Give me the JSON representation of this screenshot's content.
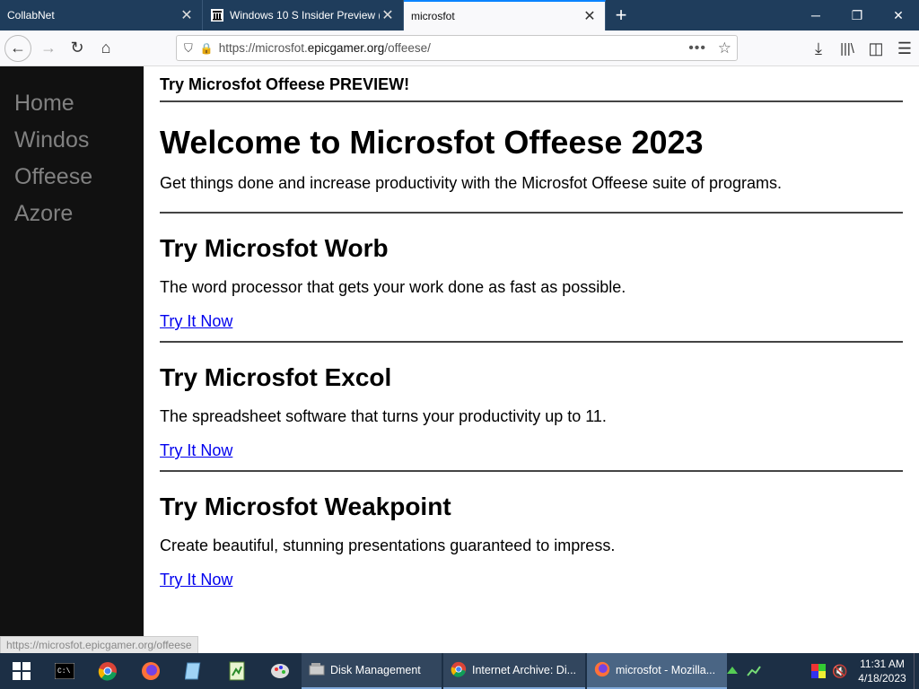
{
  "browser": {
    "tabs": [
      {
        "label": "CollabNet",
        "icon": "none"
      },
      {
        "label": "Windows 10 S Insider Preview (",
        "icon": "archive-icon"
      },
      {
        "label": "microsfot",
        "icon": "none"
      }
    ],
    "url_prefix": "https://microsfot.",
    "url_host": "epicgamer.org",
    "url_path": "/offeese/",
    "status_text": "https://microsfot.epicgamer.org/offeese"
  },
  "sidebar": {
    "items": [
      {
        "label": "Home"
      },
      {
        "label": "Windos"
      },
      {
        "label": "Offeese"
      },
      {
        "label": "Azore"
      }
    ]
  },
  "page": {
    "preview_banner": "Try Microsfot Offeese PREVIEW!",
    "title": "Welcome to Microsfot Offeese 2023",
    "intro": "Get things done and increase productivity with the Microsfot Offeese suite of programs.",
    "sections": [
      {
        "heading": "Try Microsfot Worb",
        "desc": "The word processor that gets your work done as fast as possible.",
        "link": "Try It Now"
      },
      {
        "heading": "Try Microsfot Excol",
        "desc": "The spreadsheet software that turns your productivity up to 11.",
        "link": "Try It Now"
      },
      {
        "heading": "Try Microsfot Weakpoint",
        "desc": "Create beautiful, stunning presentations guaranteed to impress.",
        "link": "Try It Now"
      }
    ]
  },
  "taskbar": {
    "apps": [
      {
        "label": "Disk Management"
      },
      {
        "label": "Internet Archive: Di..."
      },
      {
        "label": "microsfot - Mozilla..."
      }
    ],
    "time": "11:31 AM",
    "date": "4/18/2023"
  },
  "colors": {
    "sidebar_bg": "#111111",
    "sidebar_text": "#818181",
    "link": "#0000ee",
    "tab_accent": "#0a84ff"
  }
}
